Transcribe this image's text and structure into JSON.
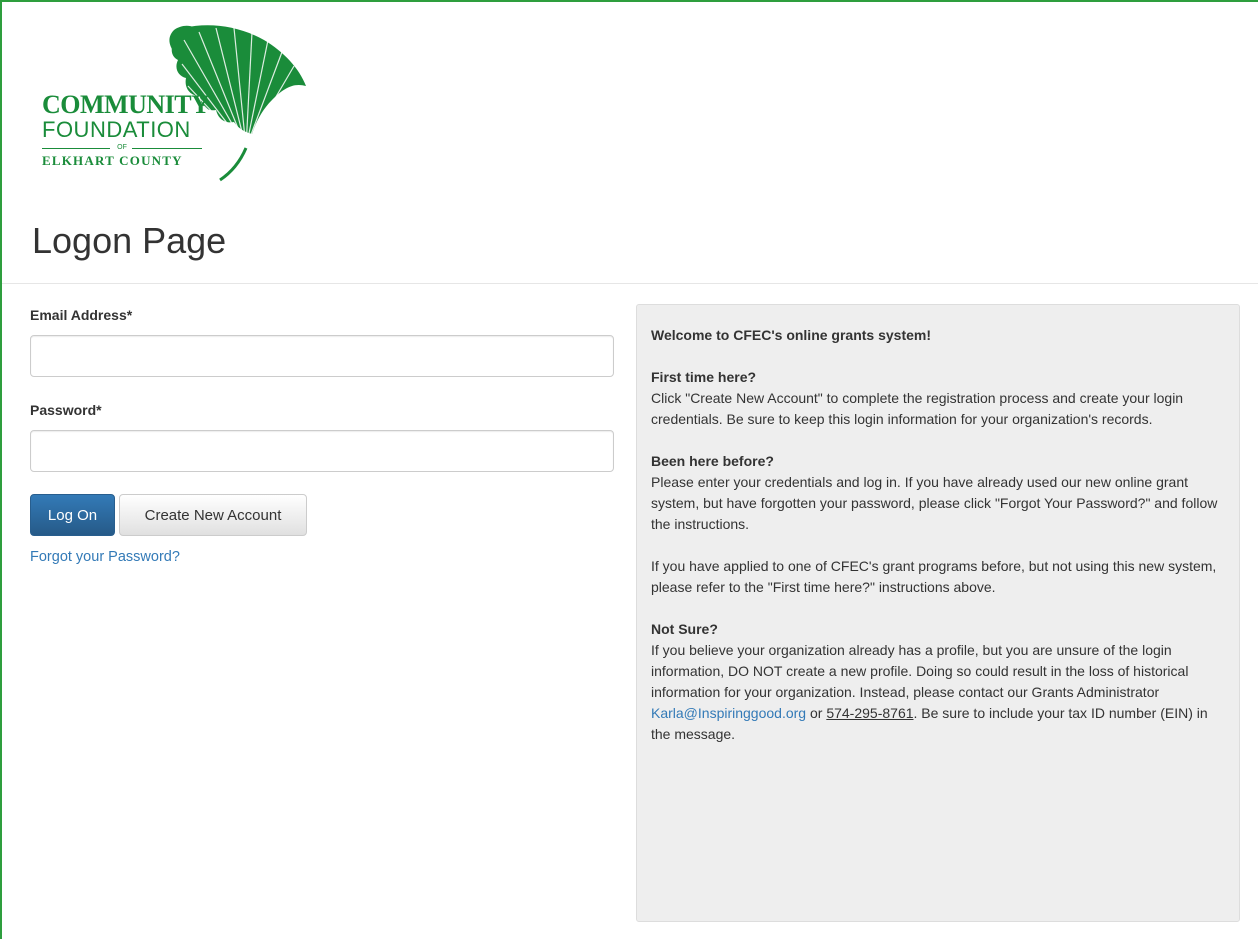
{
  "logo": {
    "line1": "COMMUNITY",
    "line2": "FOUNDATION",
    "of": "OF",
    "line3": "ELKHART COUNTY",
    "color": "#1a8c3a"
  },
  "page": {
    "title": "Logon Page"
  },
  "form": {
    "email_label": "Email Address*",
    "email_value": "",
    "password_label": "Password*",
    "password_value": "",
    "logon_button": "Log On",
    "create_button": "Create New Account",
    "forgot_link": "Forgot your Password?"
  },
  "welcome": {
    "heading": "Welcome to CFEC's online grants system!",
    "first_time_heading": "First time here?",
    "first_time_text": "Click \"Create New Account\" to complete the registration process and create your login credentials.  Be sure to keep this login information for your organization's records.",
    "been_here_heading": "Been here before?",
    "been_here_text": "Please enter your credentials and log in.  If you have already used our new online grant system, but have forgotten your password, please click \"Forgot Your Password?\" and follow the instructions.",
    "applied_text": "If you have applied to one of CFEC's grant programs before, but not using this new system, please refer to the \"First time here?\" instructions above.",
    "not_sure_heading": "Not Sure?",
    "not_sure_text": "If you believe your organization already has a profile, but you are unsure of the login information, DO NOT create a new profile.  Doing so could result in the loss of historical information for your organization.  Instead, please contact our Grants Administrator",
    "email_link": "Karla@Inspiringgood.org",
    "or_text": " or ",
    "phone": "574-295-8761",
    "tail_text": ".  Be sure to include your tax ID number (EIN) in the message."
  },
  "colors": {
    "frame_border": "#2e9e3e",
    "primary_button": "#337ab7",
    "link": "#337ab7",
    "well_bg": "#eeeeee"
  }
}
